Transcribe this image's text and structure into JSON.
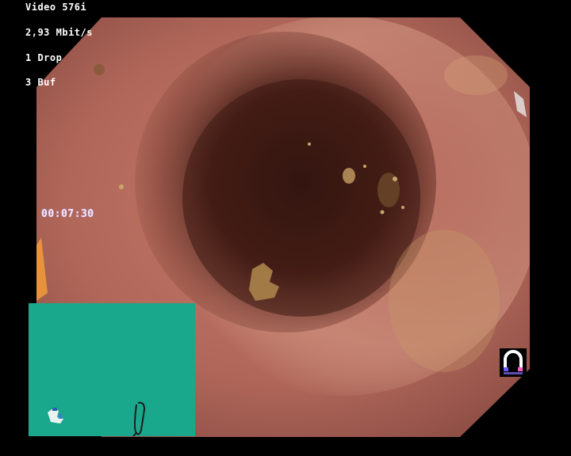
{
  "overlay": {
    "video_mode": "Video 576i",
    "bitrate": "2,93 Mbit/s",
    "dropped": "1 Drop",
    "buffered": "3 Buf"
  },
  "timer": {
    "elapsed": "00:07:30"
  },
  "colors": {
    "background": "#000000",
    "mucosa": "#b0675a",
    "lumen": "#3a1a14",
    "inset_panel": "#1aa88c",
    "overlay_text": "#ffffff"
  },
  "inset": {
    "name": "scope-position-inset",
    "cursor_icon": "scope-shape-icon"
  },
  "status_icon": "magnet-icon"
}
